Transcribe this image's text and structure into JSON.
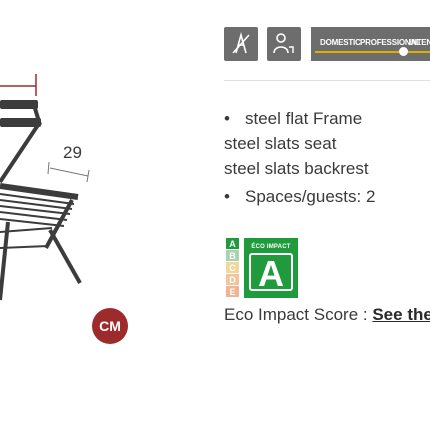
{
  "dimensions": {
    "depth_label": "29",
    "unit_label": "CM"
  },
  "usage_scale": {
    "labels": [
      "DOMESTIC",
      "PROFESSIONAL",
      "INTENS"
    ],
    "level": 0.72
  },
  "icons": {
    "first": "no-stacking-icon",
    "second": "person-flag-icon"
  },
  "specs": {
    "frame": "steel flat Frame",
    "seat": "steel slats seat",
    "backrest": "steel slats backrest",
    "guests": "Spaces/guests: 2"
  },
  "eco": {
    "scale": [
      "A",
      "B",
      "C",
      "D",
      "E"
    ],
    "badge_caption": "ÉCO IMPACT",
    "grade": "A",
    "score_label": "Eco Impact Score : ",
    "score_link": "See the"
  },
  "colors": {
    "eco_green": "#1f9a3c",
    "unit_badge": "#9e2b2b",
    "tile": "#6d6d6d",
    "track": "#e0b000"
  }
}
